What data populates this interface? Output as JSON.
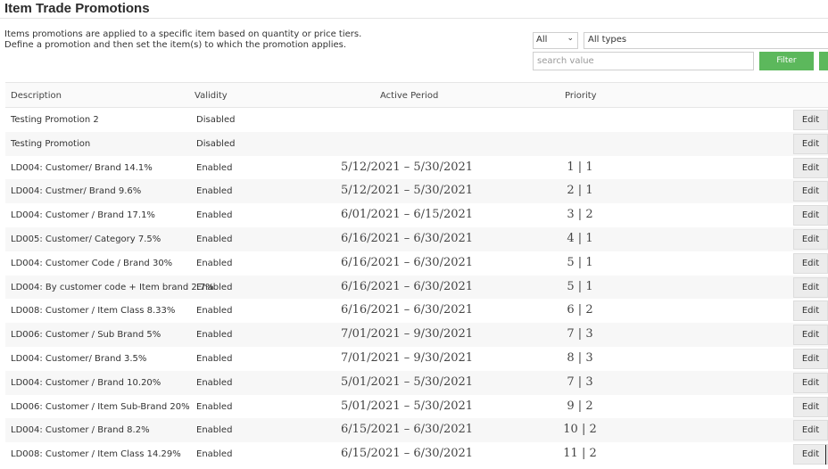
{
  "header": {
    "title": "Item Trade Promotions",
    "intro_line1": "Items promotions are applied to a specific item based on quantity or price tiers.",
    "intro_line2": "Define a promotion and then set the item(s) to which the promotion applies."
  },
  "filters": {
    "scope_value": "All",
    "type_value": "All types",
    "search_placeholder": "search value",
    "filter_label": "Filter",
    "accent_color": "#5cb85c"
  },
  "table": {
    "columns": [
      "Description",
      "Validity",
      "Active Period",
      "Priority"
    ],
    "edit_label": "Edit",
    "rows": [
      {
        "description": "Testing Promotion 2",
        "validity": "Disabled",
        "period": "",
        "priority": ""
      },
      {
        "description": "Testing Promotion",
        "validity": "Disabled",
        "period": "",
        "priority": ""
      },
      {
        "description": "LD004: Customer/ Brand 14.1%",
        "validity": "Enabled",
        "period": "5/12/2021 – 5/30/2021",
        "priority": "1 | 1"
      },
      {
        "description": "LD004: Custmer/ Brand 9.6%",
        "validity": "Enabled",
        "period": "5/12/2021 – 5/30/2021",
        "priority": "2 | 1"
      },
      {
        "description": "LD004: Customer / Brand 17.1%",
        "validity": "Enabled",
        "period": "6/01/2021 – 6/15/2021",
        "priority": "3 | 2"
      },
      {
        "description": "LD005: Customer/ Category 7.5%",
        "validity": "Enabled",
        "period": "6/16/2021 – 6/30/2021",
        "priority": "4 | 1"
      },
      {
        "description": "LD004: Customer Code / Brand 30%",
        "validity": "Enabled",
        "period": "6/16/2021 – 6/30/2021",
        "priority": "5 | 1"
      },
      {
        "description": "LD004: By customer code + Item brand 2.7%",
        "validity": "Enabled",
        "period": "6/16/2021 – 6/30/2021",
        "priority": "5 | 1"
      },
      {
        "description": "LD008: Customer / Item Class 8.33%",
        "validity": "Enabled",
        "period": "6/16/2021 – 6/30/2021",
        "priority": "6 | 2"
      },
      {
        "description": "LD006: Customer / Sub Brand 5%",
        "validity": "Enabled",
        "period": "7/01/2021 – 9/30/2021",
        "priority": "7 | 3"
      },
      {
        "description": "LD004: Customer/ Brand 3.5%",
        "validity": "Enabled",
        "period": "7/01/2021 – 9/30/2021",
        "priority": "8 | 3"
      },
      {
        "description": "LD004: Customer / Brand 10.20%",
        "validity": "Enabled",
        "period": "5/01/2021 – 5/30/2021",
        "priority": "7 | 3"
      },
      {
        "description": "LD006: Customer / Item Sub-Brand 20%",
        "validity": "Enabled",
        "period": "5/01/2021 – 5/30/2021",
        "priority": "9 | 2"
      },
      {
        "description": "LD004: Customer / Brand 8.2%",
        "validity": "Enabled",
        "period": "6/15/2021 – 6/30/2021",
        "priority": "10 | 2"
      },
      {
        "description": "LD008: Customer / Item Class 14.29%",
        "validity": "Enabled",
        "period": "6/15/2021 – 6/30/2021",
        "priority": "11 | 2"
      }
    ]
  }
}
